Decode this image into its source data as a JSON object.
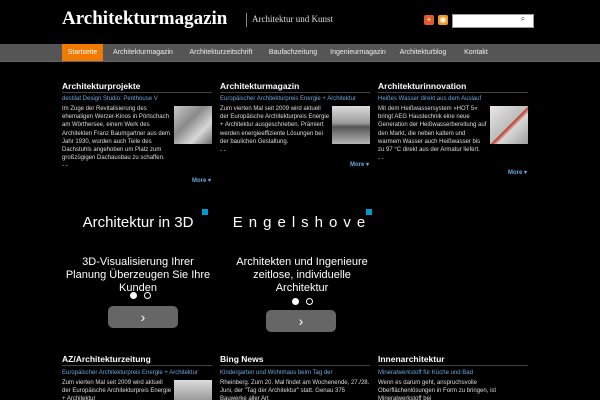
{
  "header": {
    "title": "Architekturmagazin",
    "tagline": "Architektur und Kunst",
    "icons": [
      "add-icon",
      "rss-icon"
    ],
    "search_placeholder": "",
    "search_button": "search-icon"
  },
  "nav": {
    "items": [
      {
        "label": "Startseite",
        "active": true
      },
      {
        "label": "Architekturmagazin"
      },
      {
        "label": "Architekturzeitschrift"
      },
      {
        "label": "Baufachzeitung"
      },
      {
        "label": "Ingenieurmagazin"
      },
      {
        "label": "Architekturblog"
      },
      {
        "label": "Kontakt"
      }
    ]
  },
  "columns": [
    {
      "title": "Architekturprojekte",
      "link": "destilat Design Studio: Penthouse V",
      "text": "Im Zuge der Revitalisierung des ehemaligen Werzer-Kinos in Pörtschach am Wörthersee, einem Werk des Architekten Franz Baumgartner aus dem Jahr 1930, wurden auch Teile des Dachstuhls angehoben um Platz zum großzügigen Dachausbau zu schaffen.",
      "dots": "- -",
      "more": "More ▾"
    },
    {
      "title": "Architekturmagazin",
      "link": "Europäischer Architekturpreis Energie + Architektur",
      "text": "Zum vierten Mal seit 2009 wird aktuell der Europäische Architekturpreis Energie + Architektur ausgeschrieben. Prämiert werden energieeffiziente Lösungen bei der baulichen Gestaltung.",
      "dots": "- -",
      "more": "More ▾"
    },
    {
      "title": "Architekturinnovation",
      "link": "Heißes Wasser direkt aus dem Auslauf",
      "text": "Mit dem Heißwassersystem »HOT 5« bringt AEG Haustechnik eine neue Generation der Heißwasserbereitung auf den Markt, die neben kaltem und warmem Wasser auch Heißwasser bis zu 97 °C direkt aus der Armatur liefert.",
      "dots": "- -",
      "more": "More ▾"
    }
  ],
  "ads": [
    {
      "title": "Architektur in 3D",
      "subtitle": "3D-Visualisierung Ihrer Planung Überzeugen Sie Ihre Kunden",
      "button": "›"
    },
    {
      "title": "Engelshove",
      "subtitle": "Architekten und Ingenieure zeitlose, individuelle Architektur",
      "button": "›"
    }
  ],
  "bottom": [
    {
      "title": "AZ/Architekturzeitung",
      "link": "Europäischer Architekturpreis Energie + Architektur",
      "text": "Zum vierten Mal seit 2009 wird aktuell der Europäische Architekturpreis Energie + Architektur"
    },
    {
      "title": "Bing News",
      "link": "Kindergarten und Wohnhaus beim Tag der",
      "text": "Rheinberg. Zum 20. Mal findet am Wochenende, 27./28. Juni, der \"Tag der Architektur\" statt. Genau 375 Bauwerke aller Art"
    },
    {
      "title": "Innenarchitektur",
      "link": "Mineralwerkstoff für Küche und Bad",
      "text": "Wenn es darum geht, anspruchsvolle Oberflächenlösungen in Form zu bringen, ist Mineralwerkstoff bei"
    }
  ],
  "colors": {
    "accent": "#f17a00",
    "link": "#6aa6d8",
    "nav_bg": "#555555"
  }
}
